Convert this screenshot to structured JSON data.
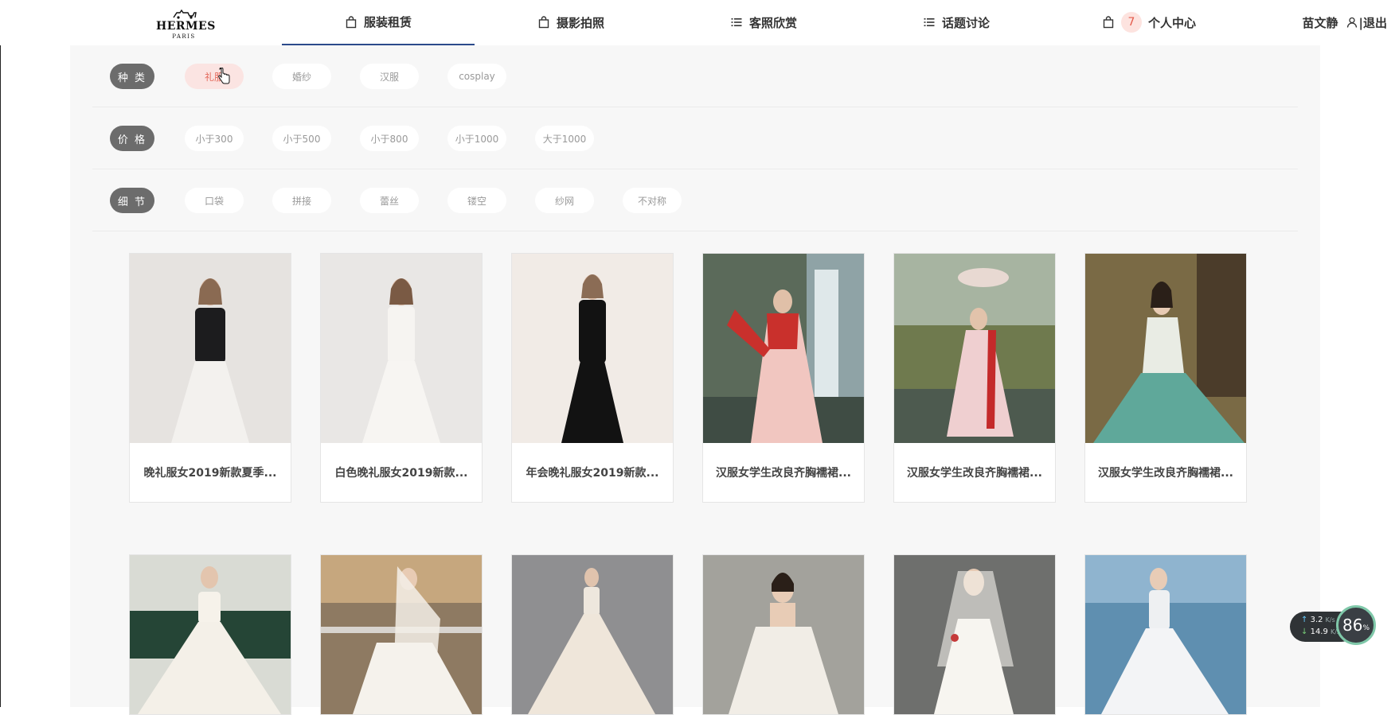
{
  "brand": {
    "name": "HERMES",
    "city": "PARIS"
  },
  "nav": {
    "items": [
      {
        "label": "服装租赁",
        "icon": "bag-icon"
      },
      {
        "label": "摄影拍照",
        "icon": "bag-icon"
      },
      {
        "label": "客照欣赏",
        "icon": "list-icon"
      },
      {
        "label": "话题讨论",
        "icon": "list-icon"
      },
      {
        "label": "个人中心",
        "icon": "bag-icon",
        "badge": "7"
      }
    ],
    "user": {
      "name": "苗文静",
      "logout": "|退出"
    }
  },
  "filters": [
    {
      "label": "种 类",
      "options": [
        "礼服",
        "婚纱",
        "汉服",
        "cosplay"
      ],
      "selected": "礼服"
    },
    {
      "label": "价 格",
      "options": [
        "小于300",
        "小于500",
        "小于800",
        "小于1000",
        "大于1000"
      ]
    },
    {
      "label": "细 节",
      "options": [
        "口袋",
        "拼接",
        "蕾丝",
        "镂空",
        "纱网",
        "不对称"
      ]
    }
  ],
  "products": [
    {
      "title": "晚礼服女2019新款夏季..."
    },
    {
      "title": "白色晚礼服女2019新款..."
    },
    {
      "title": "年会晚礼服女2019新款..."
    },
    {
      "title": "汉服女学生改良齐胸襦裙..."
    },
    {
      "title": "汉服女学生改良齐胸襦裙..."
    },
    {
      "title": "汉服女学生改良齐胸襦裙..."
    }
  ],
  "speed": {
    "up": "3.2",
    "down": "14.9",
    "unit": "K/s",
    "percent": "86",
    "percent_unit": "%"
  }
}
